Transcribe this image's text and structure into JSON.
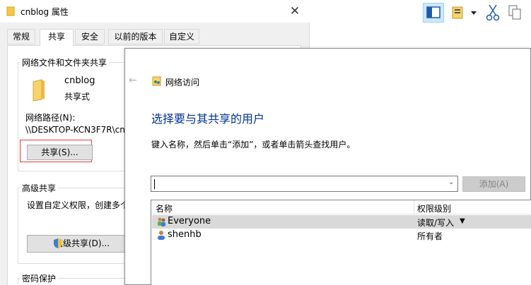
{
  "properties": {
    "title": "cnblog 属性",
    "tabs": [
      {
        "label": "常规"
      },
      {
        "label": "共享"
      },
      {
        "label": "安全"
      },
      {
        "label": "以前的版本"
      },
      {
        "label": "自定义"
      }
    ],
    "share_group": {
      "title": "网络文件和文件夹共享",
      "folder_name": "cnblog",
      "share_state": "共享式",
      "network_path_label": "网络路径(N):",
      "network_path_value": "\\\\DESKTOP-KCN3F7R\\cn",
      "share_button": "共享(S)..."
    },
    "advanced_group": {
      "title": "高级共享",
      "description": "设置自定义权限，创建多个",
      "button": "高级共享(D)..."
    },
    "password_group": {
      "title": "密码保护"
    }
  },
  "toolbar": {
    "icons": [
      "pane-layout-icon",
      "properties-icon",
      "dropdown-icon",
      "cut-icon",
      "copy-icon"
    ]
  },
  "network_access": {
    "title": "网络访问",
    "heading": "选择要与其共享的用户",
    "instruction": "键入名称，然后单击“添加”，或者单击箭头查找用户。",
    "input_value": "",
    "add_button": "添加(A)",
    "columns": {
      "name": "名称",
      "permission": "权限级别"
    },
    "users": [
      {
        "name": "Everyone",
        "permission": "读取/写入",
        "selected": true
      },
      {
        "name": "shenhb",
        "permission": "所有者",
        "selected": false
      }
    ]
  },
  "colors": {
    "heading": "#003399",
    "highlight_box": "#e63b3b",
    "selected_row": "#d9d9d9"
  }
}
